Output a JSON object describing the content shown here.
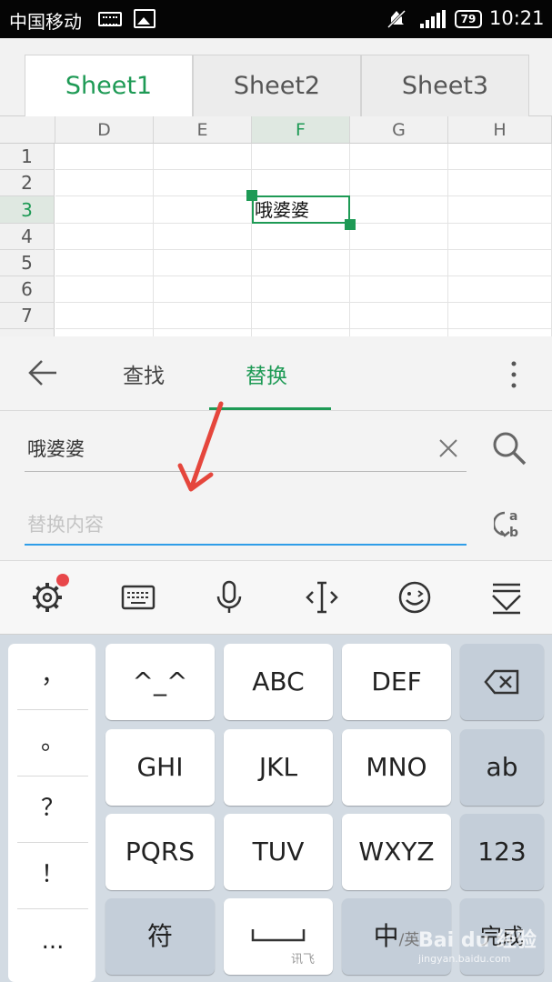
{
  "status_bar": {
    "carrier": "中国移动",
    "battery": "79",
    "time": "10:21"
  },
  "sheet_tabs": [
    {
      "label": "Sheet1",
      "active": true
    },
    {
      "label": "Sheet2",
      "active": false
    },
    {
      "label": "Sheet3",
      "active": false
    }
  ],
  "grid": {
    "columns": [
      "D",
      "E",
      "F",
      "G",
      "H"
    ],
    "selected_column": "F",
    "rows": [
      "1",
      "2",
      "3",
      "4",
      "5",
      "6",
      "7"
    ],
    "selected_row": "3",
    "cell_f3": "哦婆婆"
  },
  "find_replace": {
    "tab_find": "查找",
    "tab_replace": "替换",
    "find_value": "哦婆婆",
    "replace_placeholder": "替换内容"
  },
  "keyboard": {
    "punctuation": [
      "，",
      "。",
      "？",
      "！",
      "..."
    ],
    "keys_row1": [
      "^_^",
      "ABC",
      "DEF"
    ],
    "keys_row2": [
      "GHI",
      "JKL",
      "MNO"
    ],
    "keys_row3": [
      "PQRS",
      "TUV",
      "WXYZ"
    ],
    "symbol_key": "符",
    "space_brand": "讯飞",
    "lang_key_main": "中",
    "lang_key_sub": "/英",
    "done_key": "完成",
    "ab_key": "ab",
    "num_key": "123"
  },
  "watermark": {
    "logo": "Bai du 经验",
    "url": "jingyan.baidu.com"
  },
  "colors": {
    "accent_green": "#1e9a55",
    "input_blue": "#2f9de8",
    "annotation_red": "#e5463c"
  }
}
